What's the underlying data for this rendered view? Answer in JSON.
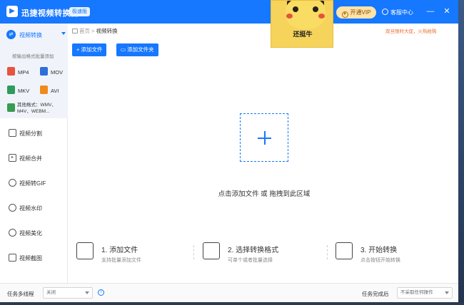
{
  "titlebar": {
    "app_title": "迅捷视频转换器",
    "edition": "极速版",
    "vip_label": "开通VIP",
    "service_label": "客服中心",
    "minimize": "—",
    "close": "✕"
  },
  "sticker": {
    "caption": "还挺牛"
  },
  "sidebar": {
    "active_section": "视频转换",
    "hint": "按输出格式批量添加",
    "formats": [
      {
        "label": "MP4",
        "color": "#e8533f"
      },
      {
        "label": "MOV",
        "color": "#2f6fd8"
      },
      {
        "label": "MKV",
        "color": "#2f9b5a"
      },
      {
        "label": "AVI",
        "color": "#f08a1d"
      }
    ],
    "other_formats": "其他格式：WMV、M4V、WEBM...",
    "items": [
      {
        "label": "视频分割",
        "icon": "split-icon"
      },
      {
        "label": "视频合并",
        "icon": "merge-icon"
      },
      {
        "label": "视频转GIF",
        "icon": "gif-icon"
      },
      {
        "label": "视频水印",
        "icon": "watermark-icon"
      },
      {
        "label": "视频美化",
        "icon": "beautify-icon"
      },
      {
        "label": "视频截图",
        "icon": "screenshot-icon"
      }
    ]
  },
  "main": {
    "breadcrumb_home": "首页",
    "breadcrumb_sep": ">",
    "breadcrumb_current": "视频转换",
    "promo": "双旦限时大促，火热抢购",
    "add_file_button": "+ 添加文件",
    "add_folder_button": "添加文件夹",
    "drop_text": "点击添加文件 或 拖拽到此区域",
    "steps": [
      {
        "title": "1. 添加文件",
        "desc": "支持批量添加文件"
      },
      {
        "title": "2. 选择转换格式",
        "desc": "可单个或者批量选择"
      },
      {
        "title": "3. 开始转换",
        "desc": "点击按钮开始转换"
      }
    ]
  },
  "statusbar": {
    "threads_label": "任务多线程",
    "threads_value": "关闭",
    "after_label": "任务完成后",
    "after_value": "不采取任何操作"
  },
  "colors": {
    "accent": "#1677ff",
    "promo": "#e86a2b"
  }
}
